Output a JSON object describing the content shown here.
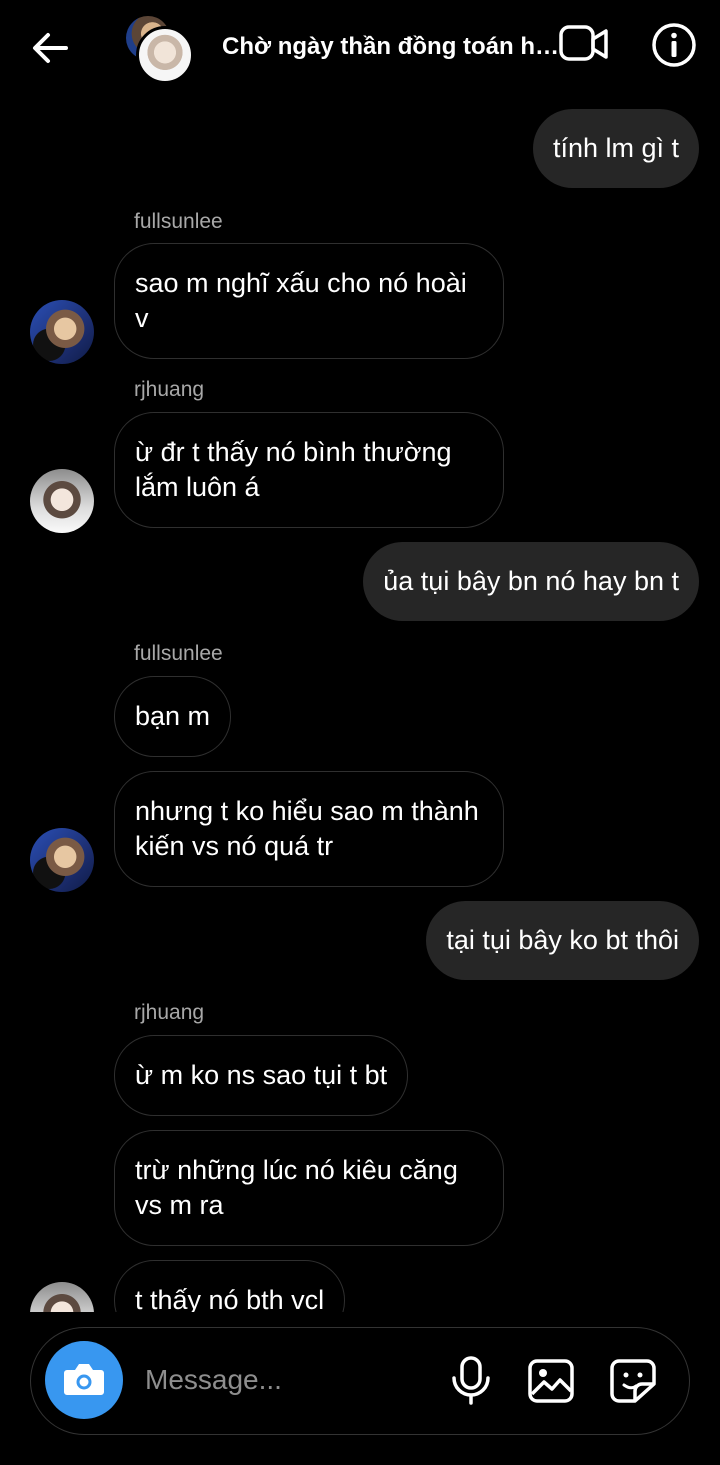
{
  "header": {
    "title": "Chờ ngày thần đồng toán h…",
    "back_icon": "arrow-left-icon",
    "video_icon": "video-camera-icon",
    "info_icon": "info-icon"
  },
  "messages": [
    {
      "type": "out",
      "text": "tính lm gì t"
    },
    {
      "type": "sender",
      "text": "fullsunlee"
    },
    {
      "type": "in",
      "text": "sao m nghĩ xấu cho nó hoài v"
    },
    {
      "type": "sender",
      "text": "rjhuang"
    },
    {
      "type": "in",
      "text": "ừ đr t thấy nó bình thường lắm luôn á"
    },
    {
      "type": "out",
      "text": "ủa tụi bây bn nó hay bn t"
    },
    {
      "type": "sender",
      "text": "fullsunlee"
    },
    {
      "type": "in",
      "text": "bạn m"
    },
    {
      "type": "in",
      "text": "nhưng t ko hiểu sao m thành kiến vs nó quá tr"
    },
    {
      "type": "out",
      "text": "tại tụi bây ko bt thôi"
    },
    {
      "type": "sender",
      "text": "rjhuang"
    },
    {
      "type": "in",
      "text": "ừ m ko ns sao tụi t bt"
    },
    {
      "type": "in",
      "text": "trừ những lúc nó kiêu căng vs m ra"
    },
    {
      "type": "in",
      "text": "t thấy nó bth vcl"
    }
  ],
  "composer": {
    "placeholder": "Message...",
    "camera_icon": "camera-icon",
    "mic_icon": "microphone-icon",
    "gallery_icon": "image-gallery-icon",
    "sticker_icon": "sticker-icon",
    "accent": "#3897f0"
  }
}
